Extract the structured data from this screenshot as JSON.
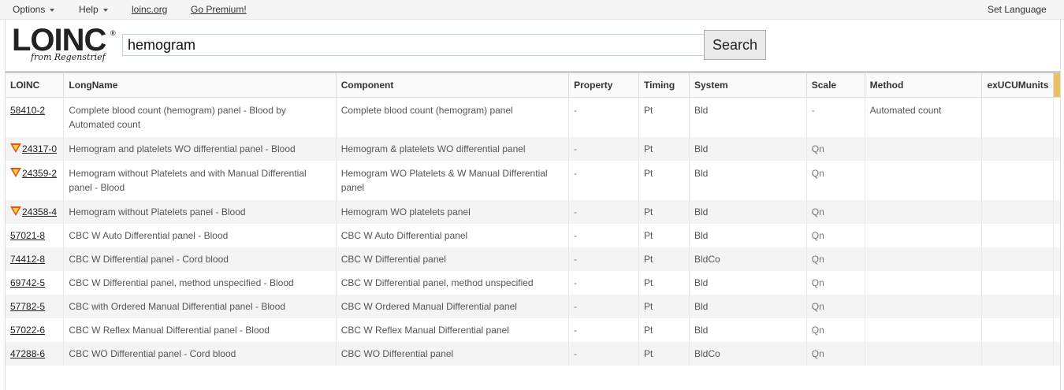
{
  "topbar": {
    "options": "Options",
    "help": "Help",
    "loinc_link": "loinc.org",
    "premium_link": "Go Premium!",
    "set_language": "Set Language"
  },
  "logo": {
    "main": "LOINC",
    "reg": "®",
    "sub": "from Regenstrief"
  },
  "search": {
    "value": "hemogram",
    "button": "Search"
  },
  "table": {
    "columns": [
      "LOINC",
      "LongName",
      "Component",
      "Property",
      "Timing",
      "System",
      "Scale",
      "Method",
      "exUCUMunits"
    ],
    "rows": [
      {
        "loinc": "58410-2",
        "warn": false,
        "longname": "Complete blood count (hemogram) panel - Blood by Automated count",
        "component": "Complete blood count (hemogram) panel",
        "property": "-",
        "timing": "Pt",
        "system": "Bld",
        "scale": "-",
        "method": "Automated count",
        "units": ""
      },
      {
        "loinc": "24317-0",
        "warn": true,
        "longname": "Hemogram and platelets WO differential panel - Blood",
        "component": "Hemogram & platelets WO differential panel",
        "property": "-",
        "timing": "Pt",
        "system": "Bld",
        "scale": "Qn",
        "method": "",
        "units": ""
      },
      {
        "loinc": "24359-2",
        "warn": true,
        "longname": "Hemogram without Platelets and with Manual Differential panel - Blood",
        "component": "Hemogram WO Platelets & W Manual Differential panel",
        "property": "-",
        "timing": "Pt",
        "system": "Bld",
        "scale": "Qn",
        "method": "",
        "units": ""
      },
      {
        "loinc": "24358-4",
        "warn": true,
        "longname": "Hemogram without Platelets panel - Blood",
        "component": "Hemogram WO platelets panel",
        "property": "-",
        "timing": "Pt",
        "system": "Bld",
        "scale": "Qn",
        "method": "",
        "units": ""
      },
      {
        "loinc": "57021-8",
        "warn": false,
        "longname": "CBC W Auto Differential panel - Blood",
        "component": "CBC W Auto Differential panel",
        "property": "-",
        "timing": "Pt",
        "system": "Bld",
        "scale": "Qn",
        "method": "",
        "units": ""
      },
      {
        "loinc": "74412-8",
        "warn": false,
        "longname": "CBC W Differential panel - Cord blood",
        "component": "CBC W Differential panel",
        "property": "-",
        "timing": "Pt",
        "system": "BldCo",
        "scale": "Qn",
        "method": "",
        "units": ""
      },
      {
        "loinc": "69742-5",
        "warn": false,
        "longname": "CBC W Differential panel, method unspecified - Blood",
        "component": "CBC W Differential panel, method unspecified",
        "property": "-",
        "timing": "Pt",
        "system": "Bld",
        "scale": "Qn",
        "method": "",
        "units": ""
      },
      {
        "loinc": "57782-5",
        "warn": false,
        "longname": "CBC with Ordered Manual Differential panel - Blood",
        "component": "CBC W Ordered Manual Differential panel",
        "property": "-",
        "timing": "Pt",
        "system": "Bld",
        "scale": "Qn",
        "method": "",
        "units": ""
      },
      {
        "loinc": "57022-6",
        "warn": false,
        "longname": "CBC W Reflex Manual Differential panel - Blood",
        "component": "CBC W Reflex Manual Differential panel",
        "property": "-",
        "timing": "Pt",
        "system": "Bld",
        "scale": "Qn",
        "method": "",
        "units": ""
      },
      {
        "loinc": "47288-6",
        "warn": false,
        "longname": "CBC WO Differential panel - Cord blood",
        "component": "CBC WO Differential panel",
        "property": "-",
        "timing": "Pt",
        "system": "BldCo",
        "scale": "Qn",
        "method": "",
        "units": ""
      }
    ]
  }
}
